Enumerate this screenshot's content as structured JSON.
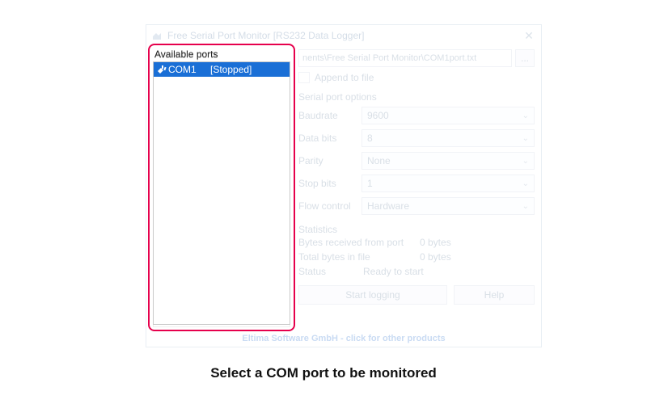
{
  "window": {
    "title": "Free Serial Port Monitor [RS232 Data Logger]"
  },
  "ports": {
    "label": "Available ports",
    "items": [
      {
        "name": "COM1",
        "status": "[Stopped]"
      }
    ]
  },
  "form": {
    "path": "nents\\Free Serial Port Monitor\\COM1port.txt",
    "browse": "...",
    "append_label": "Append to file",
    "options_title": "Serial port options",
    "baudrate_label": "Baudrate",
    "baudrate_value": "9600",
    "databits_label": "Data bits",
    "databits_value": "8",
    "parity_label": "Parity",
    "parity_value": "None",
    "stopbits_label": "Stop bits",
    "stopbits_value": "1",
    "flow_label": "Flow control",
    "flow_value": "Hardware",
    "stats_title": "Statistics",
    "bytes_rx_label": "Bytes received from port",
    "bytes_rx_value": "0 bytes",
    "bytes_file_label": "Total bytes in file",
    "bytes_file_value": "0 bytes",
    "status_label": "Status",
    "status_value": "Ready to start",
    "start_label": "Start logging",
    "help_label": "Help"
  },
  "footer": "Eltima Software GmbH - click for other products",
  "caption": "Select a COM port to be monitored"
}
